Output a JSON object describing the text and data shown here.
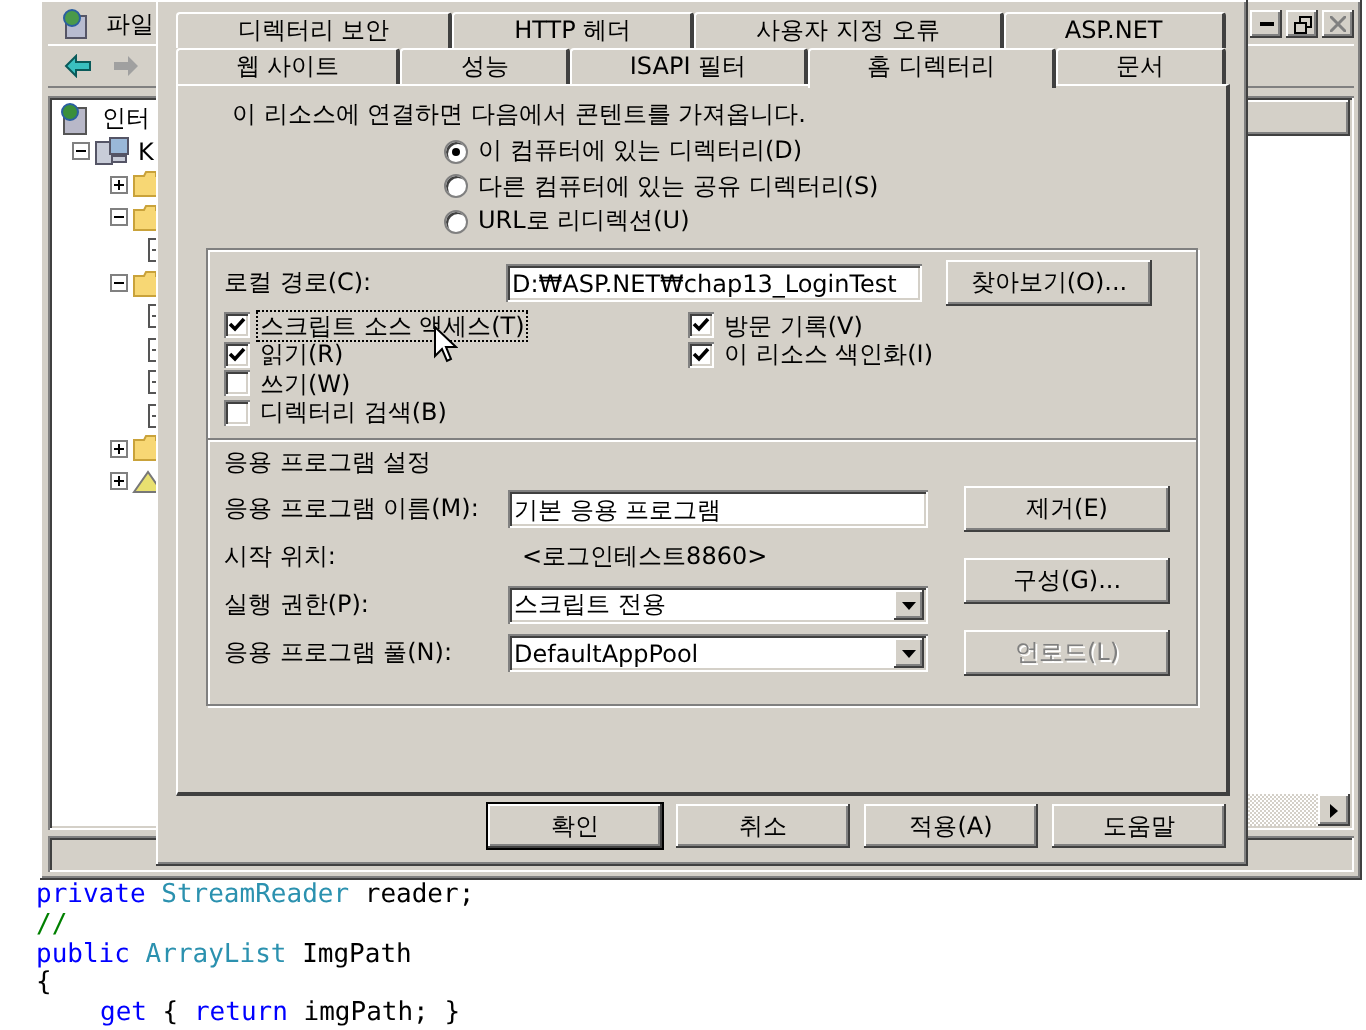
{
  "mmc_window": {
    "menu": [
      {
        "label": "파일"
      }
    ],
    "tree": [
      {
        "label": "인터",
        "kind": "globe",
        "children": [
          {
            "label": "K",
            "kind": "server",
            "expanded": true,
            "children": [
              {
                "kind": "folder",
                "expanded": false
              },
              {
                "kind": "folder",
                "expanded": true,
                "children": [
                  {
                    "kind": "page"
                  }
                ]
              },
              {
                "kind": "folder",
                "expanded": true,
                "children": [
                  {
                    "kind": "page"
                  },
                  {
                    "kind": "page"
                  },
                  {
                    "kind": "page"
                  },
                  {
                    "kind": "page"
                  }
                ]
              },
              {
                "kind": "folder",
                "expanded": false
              },
              {
                "kind": "tool",
                "expanded": false
              }
            ]
          }
        ]
      }
    ]
  },
  "dialog": {
    "tab_rows": [
      [
        {
          "label": "디렉터리 보안",
          "selected": false
        },
        {
          "label": "HTTP 헤더",
          "selected": false
        },
        {
          "label": "사용자 지정 오류",
          "selected": false
        },
        {
          "label": "ASP.NET",
          "selected": false
        }
      ],
      [
        {
          "label": "웹 사이트",
          "selected": false
        },
        {
          "label": "성능",
          "selected": false
        },
        {
          "label": "ISAPI 필터",
          "selected": false
        },
        {
          "label": "홈 디렉터리",
          "selected": true
        },
        {
          "label": "문서",
          "selected": false
        }
      ]
    ],
    "intro": "이 리소스에 연결하면 다음에서 콘텐트를 가져옵니다.",
    "source_options": [
      {
        "label": "이 컴퓨터에 있는 디렉터리(D)",
        "selected": true
      },
      {
        "label": "다른 컴퓨터에 있는 공유 디렉터리(S)",
        "selected": false
      },
      {
        "label": "URL로 리디렉션(U)",
        "selected": false
      }
    ],
    "local_path": {
      "label": "로컬 경로(C):",
      "value": "D:₩ASP.NET₩chap13_LoginTest"
    },
    "browse_button": "찾아보기(O)...",
    "permission_columns": [
      [
        {
          "label": "스크립트 소스 액세스(T)",
          "checked": true,
          "focused": true
        },
        {
          "label": "읽기(R)",
          "checked": true,
          "focused": false
        },
        {
          "label": "쓰기(W)",
          "checked": false,
          "focused": false
        },
        {
          "label": "디렉터리 검색(B)",
          "checked": false,
          "focused": false
        }
      ],
      [
        {
          "label": "방문 기록(V)",
          "checked": true,
          "focused": false
        },
        {
          "label": "이 리소스 색인화(I)",
          "checked": true,
          "focused": false
        }
      ]
    ],
    "app_settings": {
      "title": "응용 프로그램 설정",
      "rows": [
        {
          "kind": "input",
          "label": "응용 프로그램 이름(M):",
          "value": "기본 응용 프로그램"
        },
        {
          "kind": "text",
          "label": "시작 위치:",
          "value": "<로그인테스트8860>"
        },
        {
          "kind": "select",
          "label": "실행 권한(P):",
          "value": "스크립트 전용"
        },
        {
          "kind": "select",
          "label": "응용 프로그램 풀(N):",
          "value": "DefaultAppPool"
        }
      ],
      "buttons": [
        {
          "label": "제거(E)",
          "disabled": false
        },
        {
          "label": "구성(G)...",
          "disabled": false
        },
        {
          "label": "언로드(L)",
          "disabled": true
        }
      ]
    },
    "buttons": [
      {
        "label": "확인",
        "default": true
      },
      {
        "label": "취소",
        "default": false
      },
      {
        "label": "적용(A)",
        "default": false
      },
      {
        "label": "도움말",
        "default": false
      }
    ]
  },
  "editor": {
    "code_lines": [
      {
        "indented": false,
        "tokens": [
          {
            "kind": "keyword",
            "text": "private"
          },
          {
            "kind": "type",
            "text": "StreamReader"
          },
          {
            "kind": "plain",
            "text": "reader;"
          }
        ]
      },
      {
        "indented": false,
        "tokens": [
          {
            "kind": "comment",
            "text": "//"
          }
        ]
      },
      {
        "indented": false,
        "tokens": [
          {
            "kind": "keyword",
            "text": "public"
          },
          {
            "kind": "type",
            "text": "ArrayList"
          },
          {
            "kind": "plain",
            "text": "ImgPath"
          }
        ]
      },
      {
        "indented": false,
        "tokens": [
          {
            "kind": "plain",
            "text": "{"
          }
        ]
      },
      {
        "indented": true,
        "tokens": [
          {
            "kind": "keyword",
            "text": "get"
          },
          {
            "kind": "plain",
            "text": "{"
          },
          {
            "kind": "keyword",
            "text": "return"
          },
          {
            "kind": "plain",
            "text": "imgPath;"
          },
          {
            "kind": "plain",
            "text": "}"
          }
        ]
      }
    ]
  }
}
